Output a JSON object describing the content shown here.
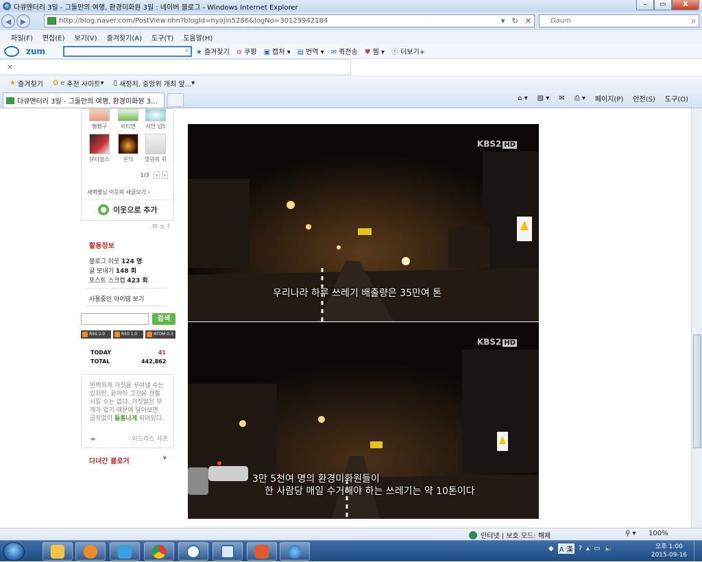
{
  "window": {
    "title": "다큐멘터리 3일 - 그들만의 여행, 환경미화원 3일 : 네이버 블로그 - Windows Internet Explorer",
    "controls": {
      "minimize": "–",
      "restore": "▭",
      "close": "X"
    }
  },
  "address_bar": {
    "url": "http://blog.naver.com/PostView.nhn?blogId=hyojin5286&logNo=30129942184",
    "search_placeholder": "Daum"
  },
  "menu": [
    "파일(F)",
    "편집(E)",
    "보기(V)",
    "즐겨찾기(A)",
    "도구(T)",
    "도움말(H)"
  ],
  "zum_toolbar": {
    "logo": "zum",
    "input_value": "",
    "tools": [
      "즐겨찾기",
      "쿠팡",
      "캡처",
      "번역",
      "퀵전송",
      "찜",
      "더보기+"
    ]
  },
  "tabx": "×",
  "favorites_bar": {
    "favorites": "즐겨찾기",
    "items": [
      "추천 사이트",
      "새정치, 중앙위 개최 앞..."
    ]
  },
  "tab": {
    "label": "다큐멘터리 3일 - 그들만의 여행, 환경미화원 3..."
  },
  "command_bar": [
    "페이지(P)",
    "안전(S)",
    "도구(O)"
  ],
  "sidebar": {
    "friends": [
      {
        "name": "뻥뻥구"
      },
      {
        "name": "비티엔"
      },
      {
        "name": "서연 넘5"
      },
      {
        "name": "뷰티얼스"
      },
      {
        "name": "온닥"
      },
      {
        "name": "영원의 위"
      }
    ],
    "pager": "1/3",
    "neighbor_link": "새벽별님 이웃의 새글보기 ›",
    "add_neighbor": "이웃으로 추가",
    "activity": {
      "title": "활동정보",
      "blog_neighbors_label": "블로그 이웃",
      "blog_neighbors": "124 명",
      "posts_sent_label": "글 보내기",
      "posts_sent": "148 회",
      "post_scrap_label": "포스트 스크랩",
      "post_scrap": "423 회",
      "items_link": "사용중인 아이템 보기"
    },
    "search_button": "검색",
    "feeds": [
      "RSS 2.0",
      "RSS 1.0",
      "ATOM 0.3"
    ],
    "counter": {
      "today_label": "TODAY",
      "today": "41",
      "total_label": "TOTAL",
      "total": "442,862"
    },
    "quote": {
      "text_before": "완벽하게 거짓을 꾸며낼 수는 있지만, 끝까지 그것을 관철시킬 수는 없다. 거짓말은 무게가 없기 때문에 달아보면 곰작없이 ",
      "highlight": "들통나게",
      "text_after": " 되어있다.",
      "author": "- 이드리스 샤흐"
    },
    "visited": "다녀간 블로거"
  },
  "video": {
    "logo": "KBS2",
    "logo_hd": "HD",
    "caption1": "우리나라 하루 쓰레기 배출량은 35만여 톤",
    "caption2_line1": "3만 5천여 명의 환경미화원들이",
    "caption2_line2": "한 사람당 매일 수거해야 하는 쓰레기는 약 10톤이다"
  },
  "status_bar": {
    "zone": "인터넷 | 보호 모드: 해제",
    "zoom": "100%"
  },
  "taskbar": {
    "time": "오후 1:00",
    "date": "2015-09-16"
  }
}
